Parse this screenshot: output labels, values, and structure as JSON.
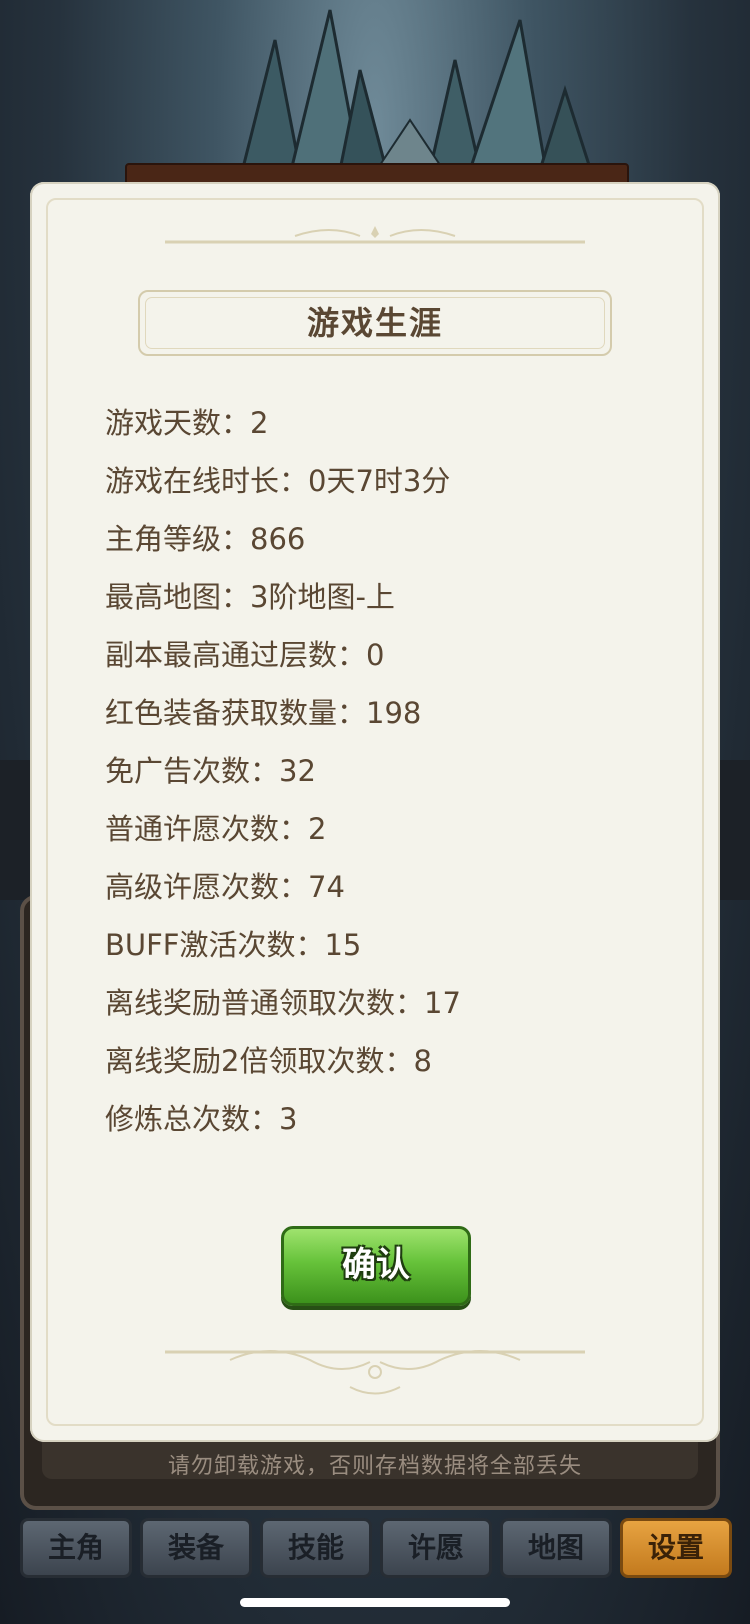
{
  "dialog": {
    "title": "游戏生涯",
    "stats": [
      "游戏天数：2",
      "游戏在线时长：0天7时3分",
      "主角等级：866",
      "最高地图：3阶地图-上",
      "副本最高通过层数：0",
      "红色装备获取数量：198",
      "免广告次数：32",
      "普通许愿次数：2",
      "高级许愿次数：74",
      "BUFF激活次数：15",
      "离线奖励普通领取次数：17",
      "离线奖励2倍领取次数：8",
      "修炼总次数：3"
    ],
    "confirm_label": "确认"
  },
  "background": {
    "warning_text": "请勿卸载游戏，否则存档数据将全部丢失"
  },
  "bottom_nav": {
    "tabs": [
      {
        "label": "主角",
        "active": false
      },
      {
        "label": "装备",
        "active": false
      },
      {
        "label": "技能",
        "active": false
      },
      {
        "label": "许愿",
        "active": false
      },
      {
        "label": "地图",
        "active": false
      },
      {
        "label": "设置",
        "active": true
      }
    ]
  },
  "colors": {
    "dialog_bg": "#f4f3eb",
    "text": "#5a4733",
    "confirm_green": "#66c23a",
    "active_tab": "#e7a341"
  }
}
